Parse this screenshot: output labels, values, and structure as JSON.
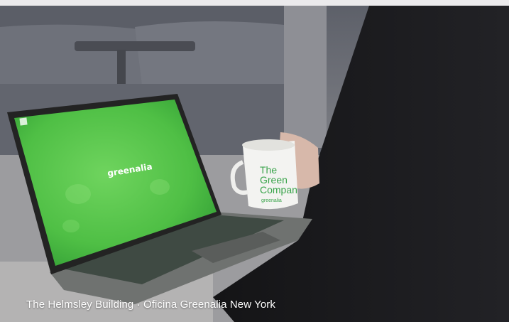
{
  "photo": {
    "caption": "The Helmsley Building · Oficina Greenalia New York",
    "laptop_screen_logo": "greenalia",
    "mug_text_lines": [
      "The",
      "Green",
      "Compan"
    ],
    "mug_brand": "greenalia"
  },
  "colors": {
    "top_band": "#ebeaec",
    "screen_green": "#55c84a",
    "sweater": "#1c1c1f",
    "sofa": "#6d7079"
  }
}
